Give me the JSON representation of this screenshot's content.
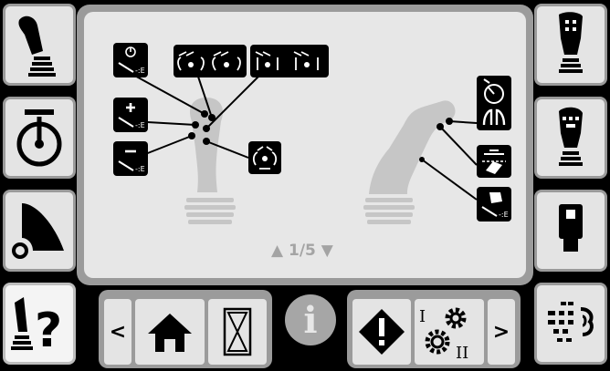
{
  "left_buttons": [
    {
      "name": "joystick-view-icon"
    },
    {
      "name": "engine-speed-icon"
    },
    {
      "name": "bucket-icon"
    },
    {
      "name": "help-joystick-icon",
      "label": "?"
    }
  ],
  "right_buttons": [
    {
      "name": "handle-front-icon"
    },
    {
      "name": "handle-switch-icon"
    },
    {
      "name": "handle-grip-icon"
    },
    {
      "name": "sensor-settings-icon"
    }
  ],
  "pager": {
    "label": "1/5"
  },
  "bottom_bar": {
    "prev_label": "<",
    "next_label": ">",
    "info_label": "i",
    "roman_one": "I",
    "roman_two": "II"
  }
}
